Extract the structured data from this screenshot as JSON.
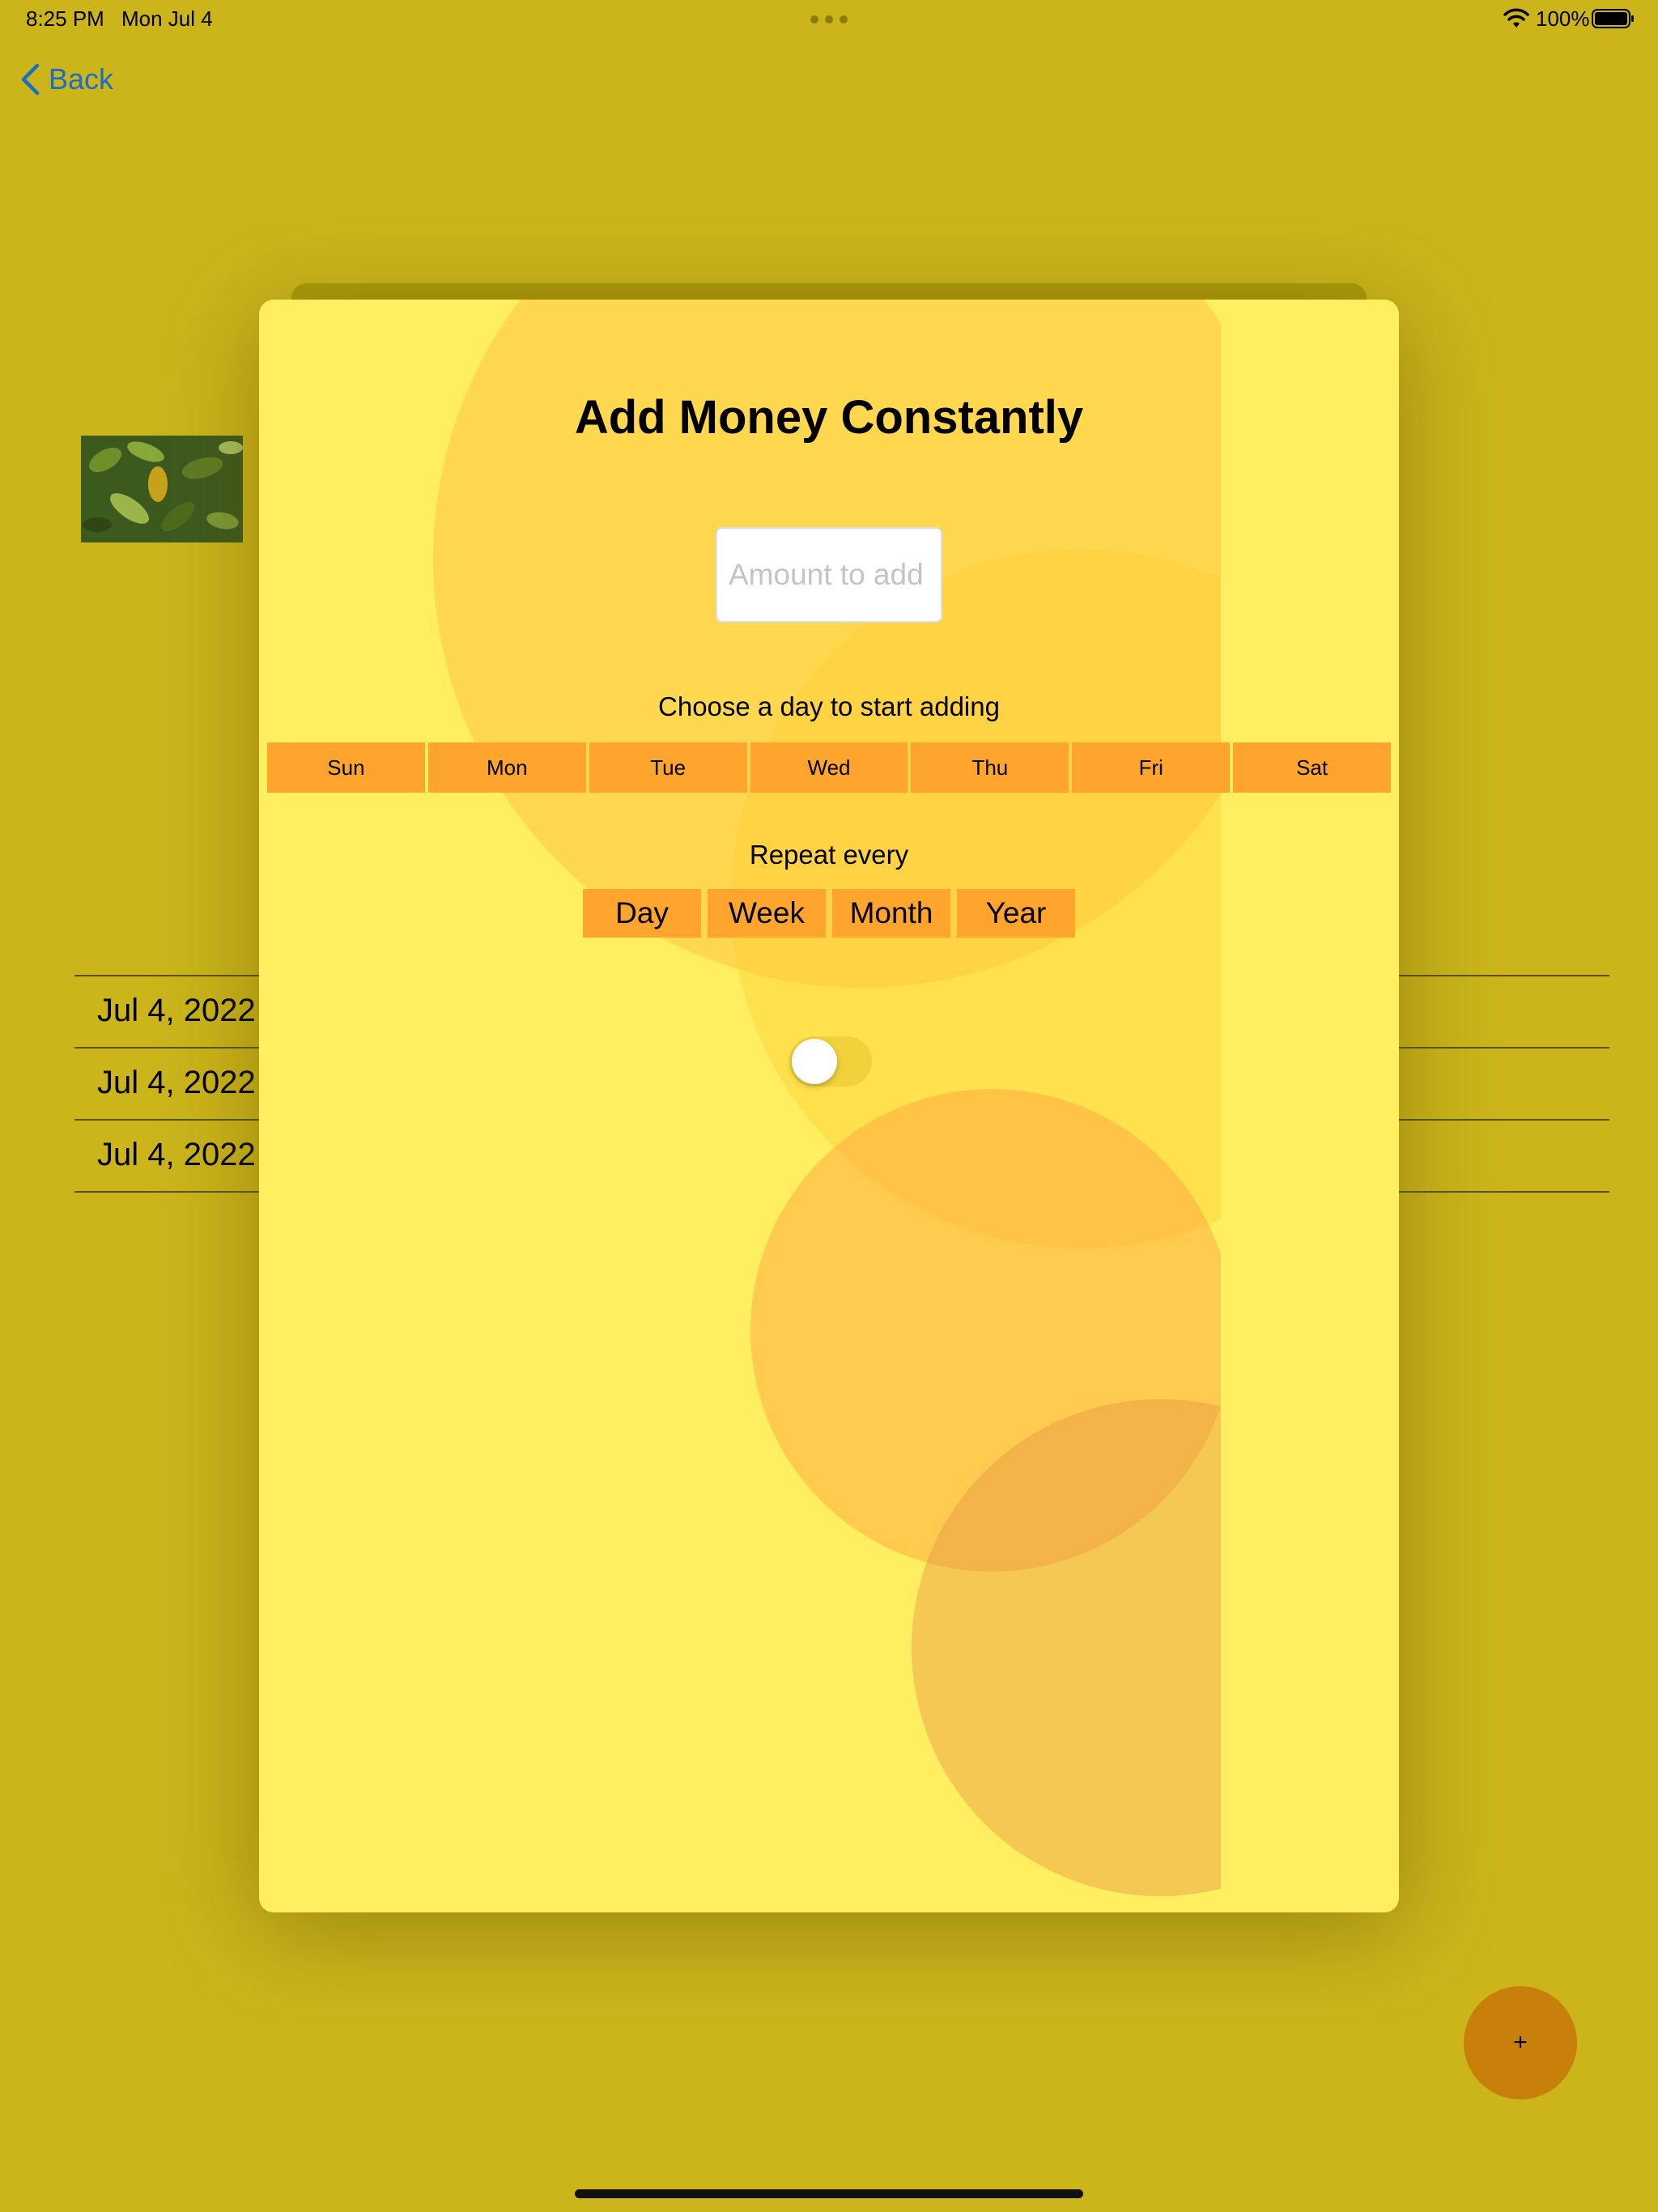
{
  "status_bar": {
    "time": "8:25 PM",
    "date": "Mon Jul 4",
    "battery": "100%"
  },
  "nav": {
    "back_label": "Back"
  },
  "background_list": {
    "rows": [
      "Jul 4, 2022",
      "Jul 4, 2022",
      "Jul 4, 2022"
    ]
  },
  "fab": {
    "label": "+"
  },
  "modal": {
    "title": "Add Money Constantly",
    "amount_placeholder": "Amount to add",
    "amount_value": "",
    "choose_label": "Choose a day to start adding",
    "days": [
      "Sun",
      "Mon",
      "Tue",
      "Wed",
      "Thu",
      "Fri",
      "Sat"
    ],
    "repeat_label": "Repeat every",
    "periods": [
      "Day",
      "Week",
      "Month",
      "Year"
    ],
    "toggle_on": false
  },
  "colors": {
    "page_background": "#cbb51b",
    "modal_background": "#ffee60",
    "button_orange": "#ffa52e",
    "fab": "#c9800a",
    "link_blue": "#1a6fc4"
  }
}
